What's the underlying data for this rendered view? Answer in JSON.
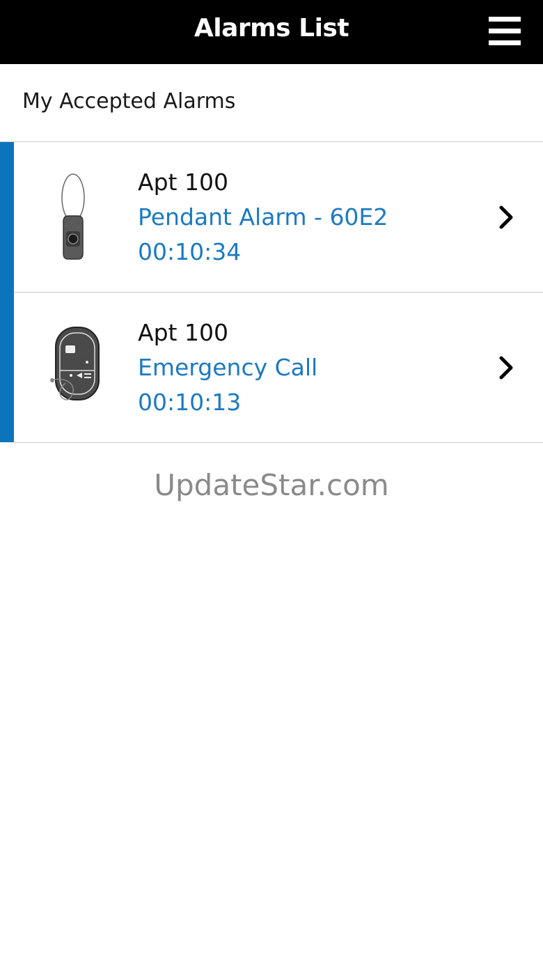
{
  "header": {
    "title": "Alarms List",
    "menu_icon": "hamburger-menu-icon"
  },
  "section": {
    "title": "My Accepted Alarms"
  },
  "alarms": [
    {
      "apartment": "Apt  100",
      "type": "Pendant  Alarm - 60E2",
      "elapsed": "00:10:34",
      "device_icon": "pendant-device-icon"
    },
    {
      "apartment": "Apt  100",
      "type": "Emergency Call",
      "elapsed": "00:10:13",
      "device_icon": "emergency-call-unit-icon"
    }
  ],
  "watermark": "UpdateStar.com",
  "colors": {
    "header_bg": "#000000",
    "accent": "#0c74bb",
    "link_text": "#1b7ac2"
  }
}
